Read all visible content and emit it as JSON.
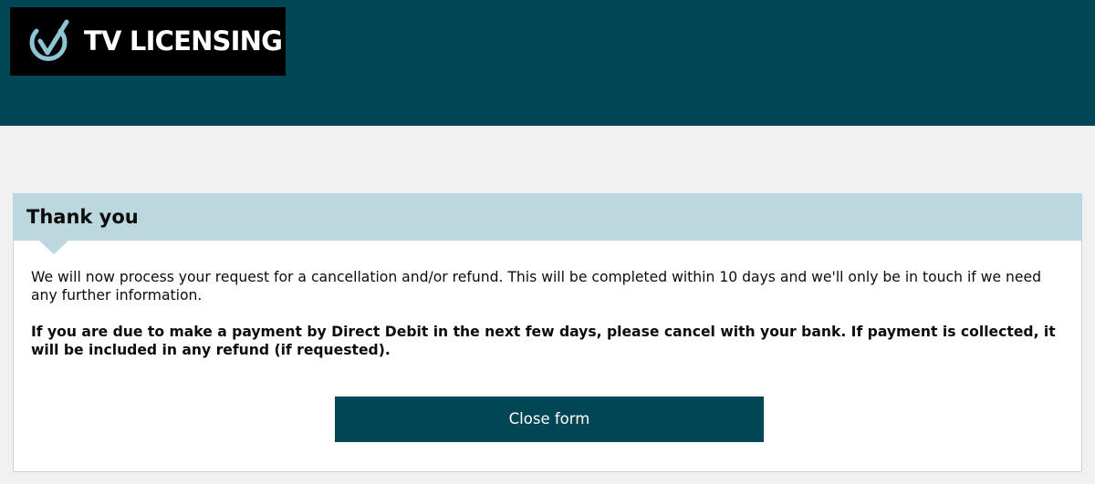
{
  "brand": {
    "logo_text": "TV LICENSING",
    "logo_icon": "tick-power-icon",
    "header_color": "#014655",
    "panel_header_color": "#bcd7de"
  },
  "panel": {
    "title": "Thank you",
    "message": "We will now process your request for a cancellation and/or refund. This will be completed within 10 days and we'll only be in touch if we need any further information.",
    "important_message": "If you are due to make a payment by Direct Debit in the next few days, please cancel with your bank. If payment is collected, it will be included in any refund (if requested)."
  },
  "actions": {
    "close_label": "Close form"
  }
}
